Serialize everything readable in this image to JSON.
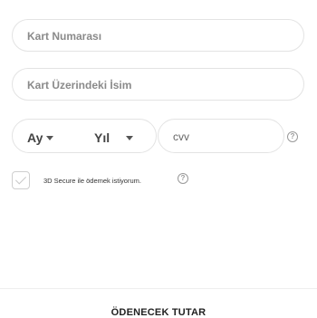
{
  "form": {
    "card_number_placeholder": "Kart Numarası",
    "card_name_placeholder": "Kart Üzerindeki İsim",
    "month_label": "Ay",
    "year_label": "Yıl",
    "cvv_placeholder": "cvv",
    "secure_label": "3D Secure ile ödemek istiyorum."
  },
  "footer": {
    "total_label": "ÖDENECEK TUTAR"
  },
  "icons": {
    "help": "question-circle-icon",
    "checkbox": "check-icon",
    "caret": "chevron-down-icon"
  }
}
